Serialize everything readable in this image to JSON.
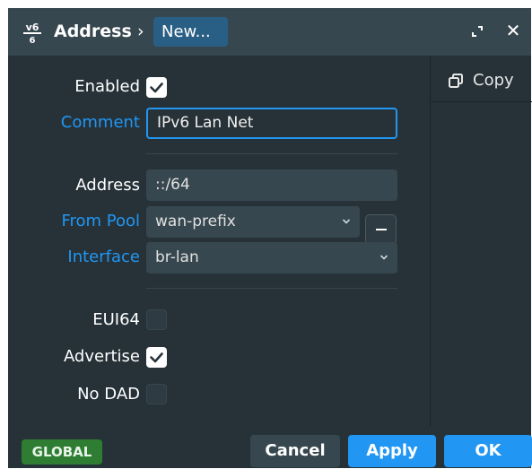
{
  "titlebar": {
    "logo_top": "v6",
    "logo_bottom": "6",
    "title": "Address",
    "separator": "›",
    "crumb": "New...",
    "close_glyph": "✕"
  },
  "sidepanel": {
    "copy_label": "Copy",
    "copy_icon": "copy-icon"
  },
  "form": {
    "enabled": {
      "label": "Enabled",
      "checked": true
    },
    "comment": {
      "label": "Comment",
      "value": "IPv6 Lan Net"
    },
    "address": {
      "label": "Address",
      "value": "::/64"
    },
    "from_pool": {
      "label": "From Pool",
      "value": "wan-prefix"
    },
    "interface": {
      "label": "Interface",
      "value": "br-lan"
    },
    "eui64": {
      "label": "EUI64",
      "checked": false
    },
    "advertise": {
      "label": "Advertise",
      "checked": true
    },
    "no_dad": {
      "label": "No DAD",
      "checked": false
    }
  },
  "footer": {
    "badge": "GLOBAL",
    "cancel": "Cancel",
    "apply": "Apply",
    "ok": "OK"
  },
  "colors": {
    "window_bg": "#263238",
    "titlebar_bg": "#37474f",
    "accent": "#2196f3",
    "crumb_bg": "#2a5f85",
    "badge_bg": "#2e7d32",
    "label_blue": "#2196f3"
  }
}
